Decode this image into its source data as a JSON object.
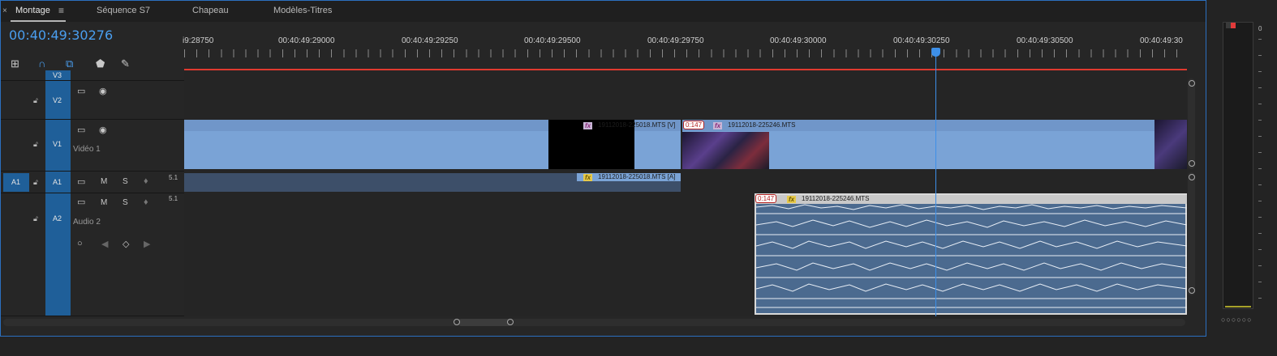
{
  "tabs": [
    {
      "label": "Montage",
      "active": true
    },
    {
      "label": "Séquence S7",
      "active": false
    },
    {
      "label": "Chapeau",
      "active": false
    },
    {
      "label": "Modèles-Titres",
      "active": false
    }
  ],
  "timecode": "00:40:49:30276",
  "ruler": [
    "i9:28750",
    "00:40:49:29000",
    "00:40:49:29250",
    "00:40:49:29500",
    "00:40:49:29750",
    "00:40:49:30000",
    "00:40:49:30250",
    "00:40:49:30500",
    "00:40:49:30"
  ],
  "tools": {
    "snap": "snap-icon",
    "linked": "linked-selection-icon",
    "marker": "add-marker-icon",
    "settings": "wrench-icon"
  },
  "tracks": {
    "v3": {
      "label": "V3"
    },
    "v2": {
      "label": "V2"
    },
    "v1": {
      "label": "V1",
      "name": "Vidéo 1"
    },
    "a1": {
      "label": "A1",
      "source": "A1",
      "mute": "M",
      "solo": "S",
      "channels": "5.1"
    },
    "a2": {
      "label": "A2",
      "name": "Audio 2",
      "mute": "M",
      "solo": "S",
      "channels": "5.1"
    }
  },
  "clips": {
    "v1a": {
      "name": "19112018-225018.MTS [V]"
    },
    "v1b": {
      "name": "19112018-225246.MTS",
      "speed": "0:147"
    },
    "a1a": {
      "name": "19112018-225018.MTS [A]"
    },
    "a2a": {
      "name": "19112018-225246.MTS",
      "speed": "0:147"
    }
  },
  "fx_label": "fx",
  "meter": {
    "scale_top": "0"
  },
  "colors": {
    "accent": "#2b6fbf",
    "playhead": "#3d8fe8",
    "video_clip": "#7aa3d6",
    "audio_clip": "#4b6a8f",
    "work_area": "#e03a2f",
    "track_target": "#1f5f99"
  }
}
